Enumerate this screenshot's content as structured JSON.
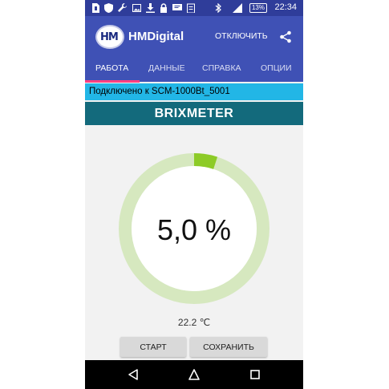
{
  "status_bar": {
    "battery_percent": "13%",
    "time": "22:34",
    "icons": [
      "sim-icon",
      "shield-icon",
      "wrench-icon",
      "image-icon",
      "download-icon",
      "lock-icon",
      "message-icon",
      "clipboard-icon",
      "bluetooth-icon",
      "signal-icon",
      "battery-icon"
    ]
  },
  "app_bar": {
    "logo_text": "HM",
    "title": "HMDigital",
    "disconnect_label": "ОТКЛЮЧИТЬ",
    "share_icon": "share-icon"
  },
  "tabs": [
    {
      "label": "РАБОТА",
      "active": true
    },
    {
      "label": "ДАННЫЕ",
      "active": false
    },
    {
      "label": "СПРАВКА",
      "active": false
    },
    {
      "label": "ОПЦИИ",
      "active": false
    }
  ],
  "connection": {
    "text": "Подключено к SCM-1000Bt_5001"
  },
  "meter": {
    "name": "BRIXMETER",
    "value_display": "5,0 %",
    "value_fraction": 0.05,
    "temperature": "22.2 ℃"
  },
  "buttons": {
    "start_label": "СТАРТ",
    "save_label": "СОХРАНИТЬ"
  },
  "nav": {
    "icons": [
      "back-icon",
      "home-icon",
      "recents-icon"
    ]
  },
  "colors": {
    "status_bar": "#2f3d9a",
    "app_bar": "#3f51b5",
    "tab_indicator": "#ff4081",
    "banner": "#22b6e6",
    "meter_header": "#136a7c",
    "gauge_track": "#d6e8bf",
    "gauge_fill": "#8dcb27"
  }
}
